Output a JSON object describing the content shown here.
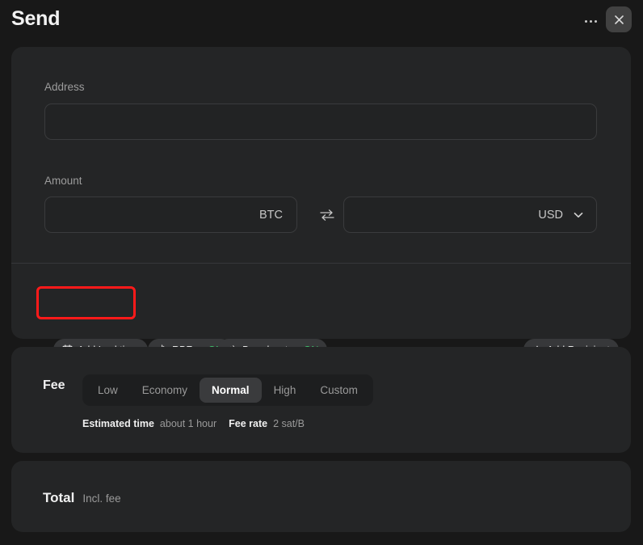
{
  "window": {
    "title": "Send",
    "more_icon": "more-horizontal-icon",
    "close_icon": "close-icon"
  },
  "form": {
    "address": {
      "label": "Address",
      "value": "",
      "placeholder": ""
    },
    "amount": {
      "label": "Amount",
      "crypto": {
        "value": "",
        "placeholder": "",
        "unit": "BTC"
      },
      "fiat": {
        "value": "",
        "placeholder": "",
        "unit": "USD",
        "chevron_icon": "chevron-down-icon"
      },
      "swap_icon": "swap-arrows-icon"
    },
    "options": [
      {
        "name": "add-locktime",
        "icon": "calendar-icon",
        "label": "Add Locktime",
        "has_value": false,
        "highlighted": true
      },
      {
        "name": "rbf",
        "icon": "replace-by-fee-icon",
        "label": "RBF",
        "has_value": true,
        "equals": "=",
        "value": "ON",
        "highlighted": false
      },
      {
        "name": "broadcast",
        "icon": "broadcast-icon",
        "label": "Broadcast",
        "has_value": true,
        "equals": "=",
        "value": "ON",
        "highlighted": false
      }
    ],
    "add_recipient": {
      "icon": "plus-icon",
      "label": "Add Recipient"
    }
  },
  "fee": {
    "label": "Fee",
    "options": [
      "Low",
      "Economy",
      "Normal",
      "High",
      "Custom"
    ],
    "selected": "Normal",
    "meta": {
      "estimated_time_label": "Estimated time",
      "estimated_time_value": "about 1 hour",
      "fee_rate_label": "Fee rate",
      "fee_rate_value": "2 sat/B"
    }
  },
  "total": {
    "label": "Total",
    "sublabel": "Incl. fee"
  },
  "colors": {
    "background": "#181818",
    "card": "#242526",
    "pill": "#37383a",
    "on_green": "#3fbf6a",
    "highlight_red": "#ff1a1a",
    "segment_active": "#3a3b3d"
  }
}
